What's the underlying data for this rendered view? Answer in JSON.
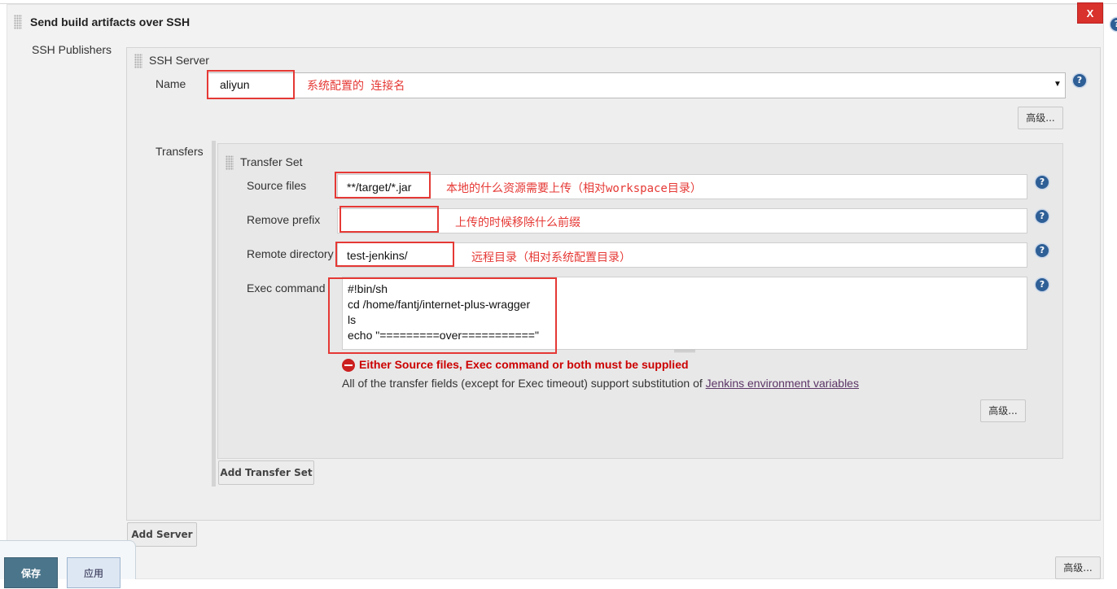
{
  "section": {
    "title": "Send build artifacts over SSH",
    "close_label": "X",
    "help_symbol": "?"
  },
  "publishers": {
    "label": "SSH Publishers"
  },
  "server": {
    "title": "SSH Server",
    "name_label": "Name",
    "name_value": "aliyun",
    "name_annotation": "系统配置的 连接名",
    "advanced_label": "高级...",
    "transfers_label": "Transfers"
  },
  "transfer_set": {
    "title": "Transfer Set",
    "source_files_label": "Source files",
    "source_files_value": "**/target/*.jar",
    "source_files_annotation": "本地的什么资源需要上传（相对workspace目录）",
    "remove_prefix_label": "Remove prefix",
    "remove_prefix_value": "",
    "remove_prefix_annotation": "上传的时候移除什么前缀",
    "remote_directory_label": "Remote directory",
    "remote_directory_value": "test-jenkins/",
    "remote_directory_annotation": "远程目录（相对系统配置目录）",
    "exec_command_label": "Exec command",
    "exec_command_lines": [
      "#!bin/sh",
      "cd /home/fantj/internet-plus-wragger",
      "ls",
      "echo \"=========over===========\""
    ],
    "error_message": "Either Source files, Exec command or both must be supplied",
    "info_text": "All of the transfer fields (except for Exec timeout) support substitution of ",
    "info_link": "Jenkins environment variables",
    "advanced_label": "高级..."
  },
  "buttons": {
    "add_transfer_set": "Add Transfer Set",
    "add_server": "Add Server",
    "advanced_bottom": "高级...",
    "save": "保存",
    "apply": "应用"
  },
  "colors": {
    "annotation_red": "#e53935",
    "error_red": "#cc0000",
    "help_blue": "#2e5f96",
    "save_blue": "#4b758b"
  }
}
